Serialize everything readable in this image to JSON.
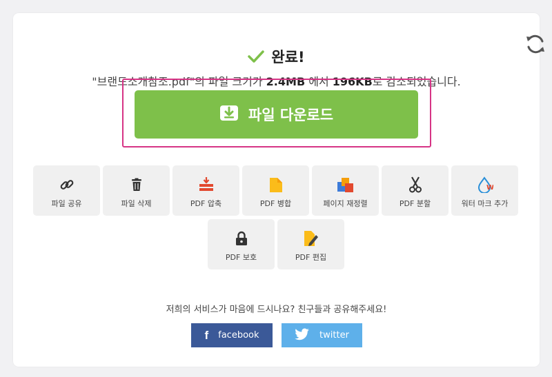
{
  "result": {
    "title": "완료!",
    "summary_prefix": "\"브랜드소개참조.pdf\"의 파일 크기가 ",
    "original_size": "2.4MB",
    "summary_middle": " 에서 ",
    "new_size": "196KB",
    "summary_suffix": "로 감소되었습니다."
  },
  "download": {
    "label": "파일 다운로드"
  },
  "tools": [
    {
      "label": "파일 공유",
      "icon": "link-icon"
    },
    {
      "label": "파일 삭제",
      "icon": "trash-icon"
    },
    {
      "label": "PDF 압축",
      "icon": "compress-icon"
    },
    {
      "label": "PDF 병합",
      "icon": "merge-icon"
    },
    {
      "label": "페이지 재정렬",
      "icon": "reorder-icon"
    },
    {
      "label": "PDF 분할",
      "icon": "scissors-icon"
    },
    {
      "label": "워터 마크 추가",
      "icon": "watermark-icon"
    },
    {
      "label": "PDF 보호",
      "icon": "lock-icon"
    },
    {
      "label": "PDF 편집",
      "icon": "edit-icon"
    }
  ],
  "share": {
    "prompt": "저희의 서비스가 마음에 드시나요? 친구들과 공유해주세요!",
    "facebook_label": "facebook",
    "twitter_label": "twitter"
  },
  "colors": {
    "accent_green": "#7ec04a",
    "highlight_pink": "#d63385",
    "facebook": "#3b5998",
    "twitter": "#5eb0ea"
  }
}
